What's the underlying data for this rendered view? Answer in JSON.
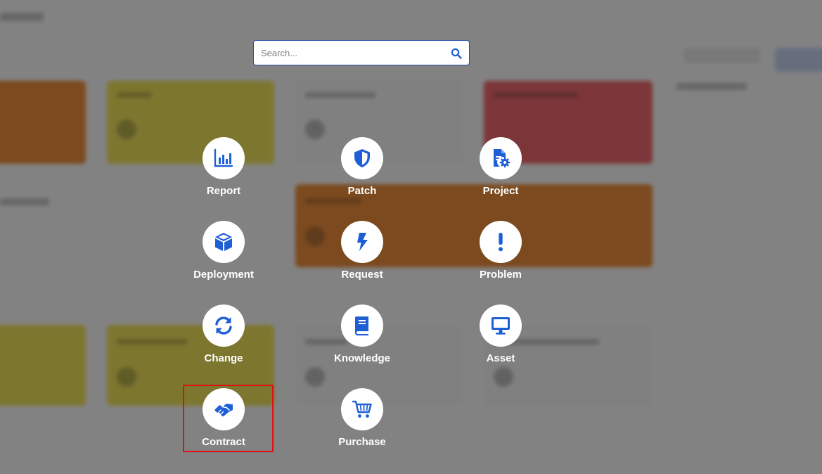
{
  "search": {
    "placeholder": "Search..."
  },
  "modules": [
    {
      "id": "report",
      "label": "Report",
      "icon": "bar-chart-icon"
    },
    {
      "id": "patch",
      "label": "Patch",
      "icon": "shield-icon"
    },
    {
      "id": "project",
      "label": "Project",
      "icon": "project-document-icon"
    },
    {
      "id": "deployment",
      "label": "Deployment",
      "icon": "box-icon"
    },
    {
      "id": "request",
      "label": "Request",
      "icon": "bolt-icon"
    },
    {
      "id": "problem",
      "label": "Problem",
      "icon": "exclamation-icon"
    },
    {
      "id": "change",
      "label": "Change",
      "icon": "sync-icon"
    },
    {
      "id": "knowledge",
      "label": "Knowledge",
      "icon": "book-icon"
    },
    {
      "id": "asset",
      "label": "Asset",
      "icon": "monitor-icon"
    },
    {
      "id": "contract",
      "label": "Contract",
      "icon": "handshake-icon"
    },
    {
      "id": "purchase",
      "label": "Purchase",
      "icon": "cart-icon"
    }
  ],
  "selected_module": "Contract",
  "colors": {
    "icon": "#1f5fd6",
    "overlay": "#5a5a5a",
    "highlight": "#e01010",
    "search_border": "#2f4fa5"
  }
}
